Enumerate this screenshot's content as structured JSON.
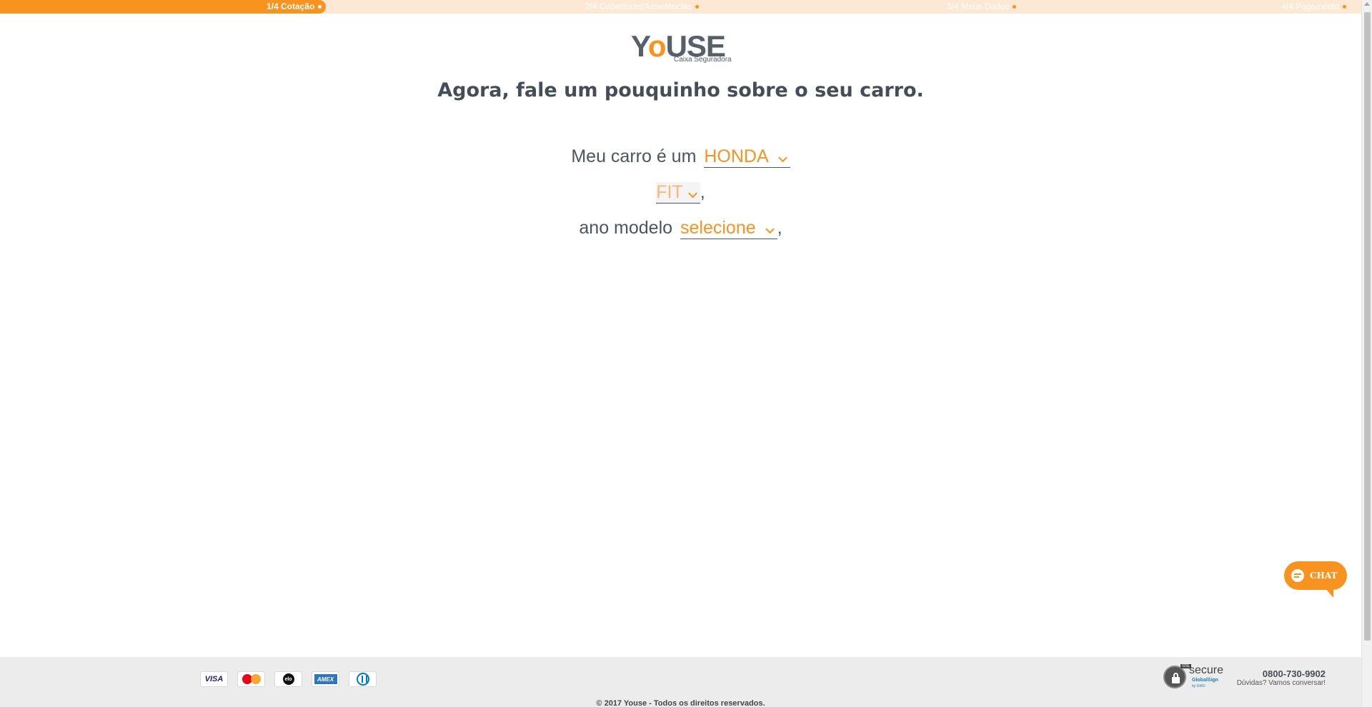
{
  "progress": {
    "steps": [
      {
        "label": "1/4 Cotação",
        "state": "active"
      },
      {
        "label": "2/4 Coberturas/Assistências",
        "state": "pending"
      },
      {
        "label": "3/4 Meus Dados",
        "state": "pending"
      },
      {
        "label": "4/4 Pagamento",
        "state": "pending"
      }
    ]
  },
  "logo": {
    "word_start": "Y",
    "word_o": "o",
    "word_end": "USE",
    "subtitle": "Caixa Seguradora"
  },
  "headline": "Agora, fale um pouquinho sobre o seu carro.",
  "form": {
    "brand_prefix": "Meu carro é um",
    "brand_value": "HONDA",
    "model_value": "FIT",
    "model_suffix": ",",
    "year_prefix": "ano modelo",
    "year_value": "selecione",
    "year_suffix": ","
  },
  "chat": {
    "label": "CHAT",
    "icon": "chat-bubble-icon"
  },
  "footer": {
    "cards": [
      {
        "name": "visa",
        "label": "VISA"
      },
      {
        "name": "mastercard",
        "label": "MasterCard"
      },
      {
        "name": "elo",
        "label": "elo"
      },
      {
        "name": "amex",
        "label": "AMEX"
      },
      {
        "name": "diners",
        "label": ""
      }
    ],
    "secure": {
      "ssl": "SSL",
      "word": "secure",
      "brand": "GlobalSign",
      "sub": "by GMO"
    },
    "phone": "0800-730-9902",
    "phone_sub": "Dúvidas? Vamos conversar!",
    "copyright": "© 2017 Youse - Todos os direitos reservados."
  },
  "colors": {
    "accent": "#f7931e",
    "text": "#4a5560",
    "footer_bg": "#ececec"
  }
}
